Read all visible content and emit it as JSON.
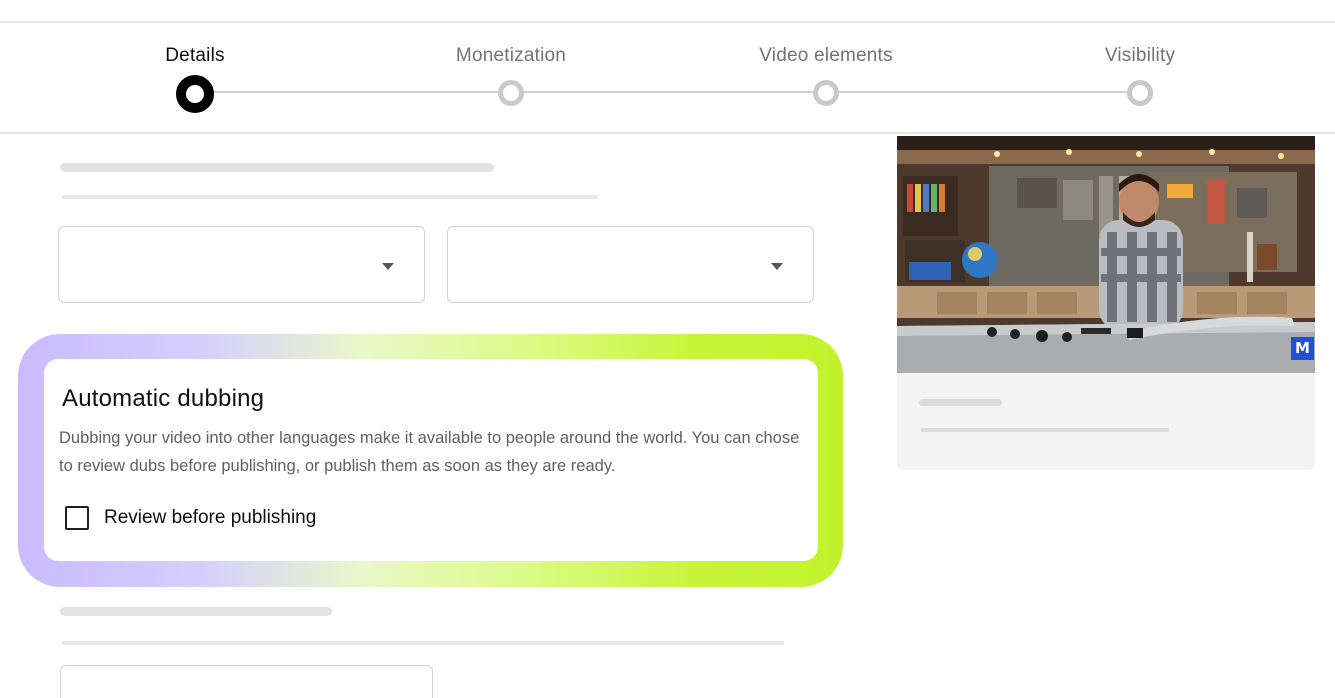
{
  "stepper": {
    "steps": [
      {
        "label": "Details",
        "state": "active"
      },
      {
        "label": "Monetization",
        "state": "pending"
      },
      {
        "label": "Video elements",
        "state": "pending"
      },
      {
        "label": "Visibility",
        "state": "pending"
      }
    ]
  },
  "dubbing": {
    "title": "Automatic dubbing",
    "description": "Dubbing your video into other languages make it available to people around the world. You can chose to review dubs before publishing, or publish them as soon as they are ready.",
    "checkbox_label": "Review before publishing",
    "checkbox_checked": false
  },
  "preview": {
    "badge": "M"
  },
  "colors": {
    "glow_start": "#c8bcff",
    "glow_end": "#c2f22c",
    "active_step": "#000000",
    "badge": "#1f4fd9"
  },
  "icons": [
    "chevron-down-icon",
    "checkbox-icon",
    "step-dot-icon"
  ]
}
